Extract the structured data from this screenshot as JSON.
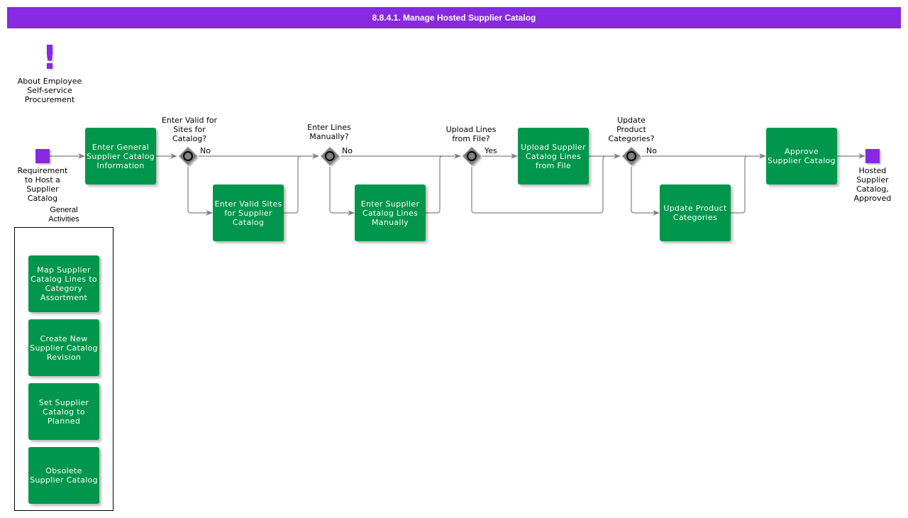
{
  "header": {
    "title": "8.8.4.1. Manage Hosted Supplier Catalog"
  },
  "colors": {
    "accent": "#8629e0",
    "task": "#00964b",
    "gateway": "#808080",
    "connector": "#808080"
  },
  "about": {
    "icon": "exclamation-icon",
    "label": "About Employee\nSelf-service\nProcurement"
  },
  "start_event": {
    "label": "Requirement\nto Host a\nSupplier\nCatalog"
  },
  "end_event": {
    "label": "Hosted\nSupplier\nCatalog,\nApproved"
  },
  "tasks": {
    "enter_general": "Enter General\nSupplier Catalog\nInformation",
    "enter_valid_sites": "Enter Valid Sites\nfor Supplier\nCatalog",
    "enter_lines_manually": "Enter Supplier\nCatalog Lines\nManually",
    "upload_lines": "Upload Supplier\nCatalog Lines\nfrom File",
    "update_categories": "Update Product\nCategories",
    "approve": "Approve\nSupplier Catalog"
  },
  "gateways": [
    {
      "question": "Enter Valid for\nSites for\nCatalog?",
      "branch_label": "No"
    },
    {
      "question": "Enter Lines\nManually?",
      "branch_label": "No"
    },
    {
      "question": "Upload Lines\nfrom File?",
      "branch_label": "Yes"
    },
    {
      "question": "Update\nProduct\nCategories?",
      "branch_label": "No"
    }
  ],
  "general_activities": {
    "title": "General\nActivities",
    "items": [
      "Map Supplier\nCatalog Lines to\nCategory\nAssortment",
      "Create New\nSupplier Catalog\nRevision",
      "Set Supplier\nCatalog to\nPlanned",
      "Obsolete\nSupplier Catalog"
    ]
  }
}
